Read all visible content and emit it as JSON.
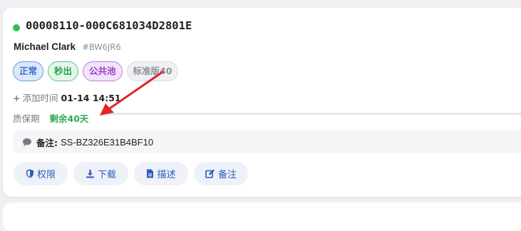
{
  "order": {
    "id": "00008110-000C681034D2801E",
    "status_color": "#2dbf57"
  },
  "user": {
    "name": "Michael Clark",
    "code": "#BW6JR6"
  },
  "tags": [
    {
      "label": "正常",
      "color": "#3d6fd0"
    },
    {
      "label": "秒出",
      "color": "#25a04c"
    },
    {
      "label": "公共池",
      "color": "#9c3fc9"
    },
    {
      "label": "标准版40",
      "color": "#8d9198"
    }
  ],
  "added_time": {
    "label": "添加时间",
    "value": "01-14 14:51"
  },
  "warranty": {
    "label": "质保期",
    "value": "剩余40天"
  },
  "remark": {
    "label": "备注:",
    "value": "SS-BZ326E31B4BF10"
  },
  "actions": {
    "permission": "权限",
    "download": "下载",
    "describe": "描述",
    "remark": "备注"
  },
  "annotation_color": "#e0262a"
}
